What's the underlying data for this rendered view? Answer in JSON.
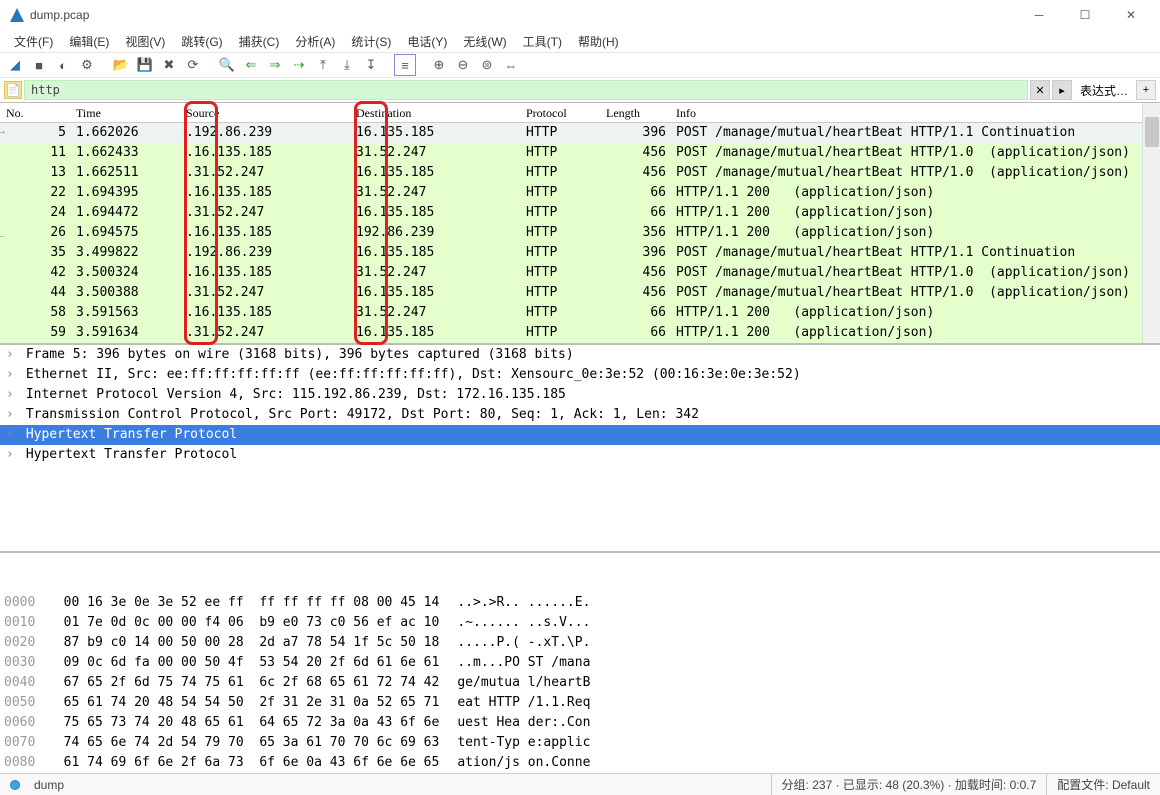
{
  "window": {
    "title": "dump.pcap",
    "min_tip": "最小化",
    "max_tip": "最大化",
    "close_tip": "关闭"
  },
  "menu": {
    "file": "文件(F)",
    "edit": "编辑(E)",
    "view": "视图(V)",
    "go": "跳转(G)",
    "capture": "捕获(C)",
    "analyze": "分析(A)",
    "statistics": "统计(S)",
    "telephony": "电话(Y)",
    "wireless": "无线(W)",
    "tools": "工具(T)",
    "help": "帮助(H)"
  },
  "filter": {
    "value": "http",
    "expression_label": "表达式…"
  },
  "columns": {
    "no": "No.",
    "time": "Time",
    "source": "Source",
    "destination": "Destination",
    "protocol": "Protocol",
    "length": "Length",
    "info": "Info"
  },
  "packets": [
    {
      "no": "5",
      "time": "1.662026",
      "src": ".192.86.239",
      "dst": "16.135.185",
      "proto": "HTTP",
      "len": "396",
      "info": "POST /manage/mutual/heartBeat HTTP/1.1 Continuation",
      "sel": true
    },
    {
      "no": "11",
      "time": "1.662433",
      "src": ".16.135.185",
      "dst": "31.52.247",
      "proto": "HTTP",
      "len": "456",
      "info": "POST /manage/mutual/heartBeat HTTP/1.0  (application/json)"
    },
    {
      "no": "13",
      "time": "1.662511",
      "src": ".31.52.247",
      "dst": "16.135.185",
      "proto": "HTTP",
      "len": "456",
      "info": "POST /manage/mutual/heartBeat HTTP/1.0  (application/json)"
    },
    {
      "no": "22",
      "time": "1.694395",
      "src": ".16.135.185",
      "dst": "31.52.247",
      "proto": "HTTP",
      "len": "66",
      "info": "HTTP/1.1 200   (application/json)"
    },
    {
      "no": "24",
      "time": "1.694472",
      "src": ".31.52.247",
      "dst": "16.135.185",
      "proto": "HTTP",
      "len": "66",
      "info": "HTTP/1.1 200   (application/json)"
    },
    {
      "no": "26",
      "time": "1.694575",
      "src": ".16.135.185",
      "dst": "192.86.239",
      "proto": "HTTP",
      "len": "356",
      "info": "HTTP/1.1 200   (application/json)"
    },
    {
      "no": "35",
      "time": "3.499822",
      "src": ".192.86.239",
      "dst": "16.135.185",
      "proto": "HTTP",
      "len": "396",
      "info": "POST /manage/mutual/heartBeat HTTP/1.1 Continuation"
    },
    {
      "no": "42",
      "time": "3.500324",
      "src": ".16.135.185",
      "dst": "31.52.247",
      "proto": "HTTP",
      "len": "456",
      "info": "POST /manage/mutual/heartBeat HTTP/1.0  (application/json)"
    },
    {
      "no": "44",
      "time": "3.500388",
      "src": ".31.52.247",
      "dst": "16.135.185",
      "proto": "HTTP",
      "len": "456",
      "info": "POST /manage/mutual/heartBeat HTTP/1.0  (application/json)"
    },
    {
      "no": "58",
      "time": "3.591563",
      "src": ".16.135.185",
      "dst": "31.52.247",
      "proto": "HTTP",
      "len": "66",
      "info": "HTTP/1.1 200   (application/json)"
    },
    {
      "no": "59",
      "time": "3.591634",
      "src": ".31.52.247",
      "dst": "16.135.185",
      "proto": "HTTP",
      "len": "66",
      "info": "HTTP/1.1 200   (application/json)"
    }
  ],
  "details": [
    "Frame 5: 396 bytes on wire (3168 bits), 396 bytes captured (3168 bits)",
    "Ethernet II, Src: ee:ff:ff:ff:ff:ff (ee:ff:ff:ff:ff:ff), Dst: Xensourc_0e:3e:52 (00:16:3e:0e:3e:52)",
    "Internet Protocol Version 4, Src: 115.192.86.239, Dst: 172.16.135.185",
    "Transmission Control Protocol, Src Port: 49172, Dst Port: 80, Seq: 1, Ack: 1, Len: 342",
    "Hypertext Transfer Protocol",
    "Hypertext Transfer Protocol"
  ],
  "details_selected_index": 4,
  "hex": [
    {
      "off": "0000",
      "b": "00 16 3e 0e 3e 52 ee ff  ff ff ff ff 08 00 45 14",
      "a": "..>.>R.. ......E."
    },
    {
      "off": "0010",
      "b": "01 7e 0d 0c 00 00 f4 06  b9 e0 73 c0 56 ef ac 10",
      "a": ".~...... ..s.V..."
    },
    {
      "off": "0020",
      "b": "87 b9 c0 14 00 50 00 28  2d a7 78 54 1f 5c 50 18",
      "a": ".....P.( -.xT.\\P."
    },
    {
      "off": "0030",
      "b": "09 0c 6d fa 00 00 50 4f  53 54 20 2f 6d 61 6e 61",
      "a": "..m...PO ST /mana"
    },
    {
      "off": "0040",
      "b": "67 65 2f 6d 75 74 75 61  6c 2f 68 65 61 72 74 42",
      "a": "ge/mutua l/heartB"
    },
    {
      "off": "0050",
      "b": "65 61 74 20 48 54 54 50  2f 31 2e 31 0a 52 65 71",
      "a": "eat HTTP /1.1.Req"
    },
    {
      "off": "0060",
      "b": "75 65 73 74 20 48 65 61  64 65 72 3a 0a 43 6f 6e",
      "a": "uest Hea der:.Con"
    },
    {
      "off": "0070",
      "b": "74 65 6e 74 2d 54 79 70  65 3a 61 70 70 6c 69 63",
      "a": "tent-Typ e:applic"
    },
    {
      "off": "0080",
      "b": "61 74 69 6f 6e 2f 6a 73  6f 6e 0a 43 6f 6e 6e 65",
      "a": "ation/js on.Conne"
    }
  ],
  "status": {
    "file": "dump",
    "packets": "分组: 237 · 已显示: 48 (20.3%) · 加载时间: 0:0.7",
    "profile": "配置文件: Default"
  }
}
